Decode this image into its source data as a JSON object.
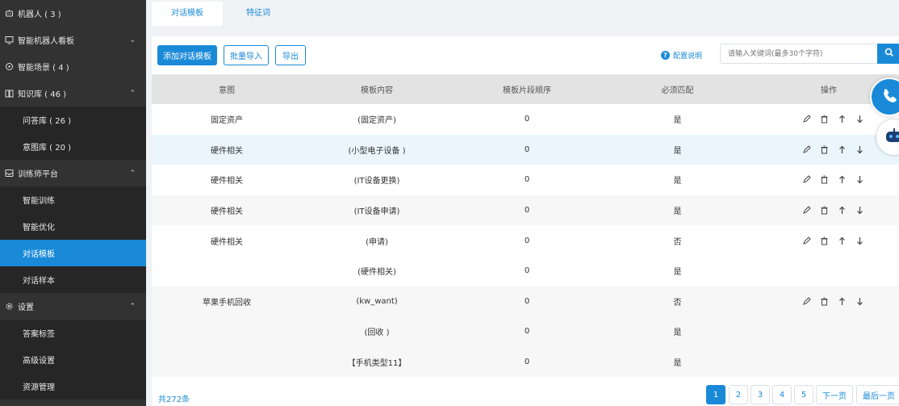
{
  "sidebar": {
    "items": [
      {
        "label": "机器人 ( 3 )",
        "icon": "robot-icon",
        "chevron": ""
      },
      {
        "label": "智能机器人看板",
        "icon": "monitor-icon",
        "chevron": "down"
      },
      {
        "label": "智能场景 ( 4 )",
        "icon": "scene-icon",
        "chevron": ""
      },
      {
        "label": "知识库 ( 46 )",
        "icon": "book-icon",
        "chevron": "up"
      },
      {
        "label": "问答库 ( 26 )",
        "sub": true
      },
      {
        "label": "意图库 ( 20 )",
        "sub": true
      },
      {
        "label": "训练师平台",
        "icon": "inbox-icon",
        "chevron": "up"
      },
      {
        "label": "智能训练",
        "sub": true
      },
      {
        "label": "智能优化",
        "sub": true
      },
      {
        "label": "对话模板",
        "sub": true,
        "active": true
      },
      {
        "label": "对话样本",
        "sub": true
      },
      {
        "label": "设置",
        "icon": "gear-icon",
        "chevron": "up"
      },
      {
        "label": "答案标签",
        "sub": true
      },
      {
        "label": "高级设置",
        "sub": true
      },
      {
        "label": "资源管理",
        "sub": true
      }
    ]
  },
  "tabs": [
    {
      "label": "对话模板",
      "active": true
    },
    {
      "label": "特征词",
      "active": false
    }
  ],
  "toolbar": {
    "add_label": "添加对话模板",
    "import_label": "批量导入",
    "export_label": "导出",
    "help_label": "配置说明",
    "search_placeholder": "请输入关键词(最多30个字符)"
  },
  "table": {
    "headers": [
      "意图",
      "模板内容",
      "模板片段顺序",
      "必须匹配",
      "操作"
    ],
    "rows": [
      {
        "intent": "固定资产",
        "content": "(固定资产)",
        "order": "0",
        "must": "是",
        "ops": true,
        "style": ""
      },
      {
        "intent": "硬件相关",
        "content": "(小型电子设备 )",
        "order": "0",
        "must": "是",
        "ops": true,
        "style": "hl"
      },
      {
        "intent": "硬件相关",
        "content": "(IT设备更换)",
        "order": "0",
        "must": "是",
        "ops": true,
        "style": ""
      },
      {
        "intent": "硬件相关",
        "content": "(IT设备申请)",
        "order": "0",
        "must": "是",
        "ops": true,
        "style": "alt"
      },
      {
        "intent": "硬件相关",
        "content": "(申请)",
        "order": "0",
        "must": "否",
        "ops": true,
        "style": ""
      },
      {
        "intent": "",
        "content": "(硬件相关)",
        "order": "0",
        "must": "是",
        "ops": false,
        "style": ""
      },
      {
        "intent": "苹果手机回收",
        "content": "(kw_want)",
        "order": "0",
        "must": "否",
        "ops": true,
        "style": "alt"
      },
      {
        "intent": "",
        "content": "(回收 )",
        "order": "0",
        "must": "是",
        "ops": false,
        "style": "alt"
      },
      {
        "intent": "",
        "content": "【手机类型11】",
        "order": "0",
        "must": "是",
        "ops": false,
        "style": "alt"
      }
    ]
  },
  "pagination": {
    "total": "共272条",
    "pages": [
      "1",
      "2",
      "3",
      "4",
      "5"
    ],
    "next": "下一页",
    "last": "最后一页"
  },
  "colors": {
    "accent": "#1a8ad8",
    "sidebar": "#323232"
  }
}
